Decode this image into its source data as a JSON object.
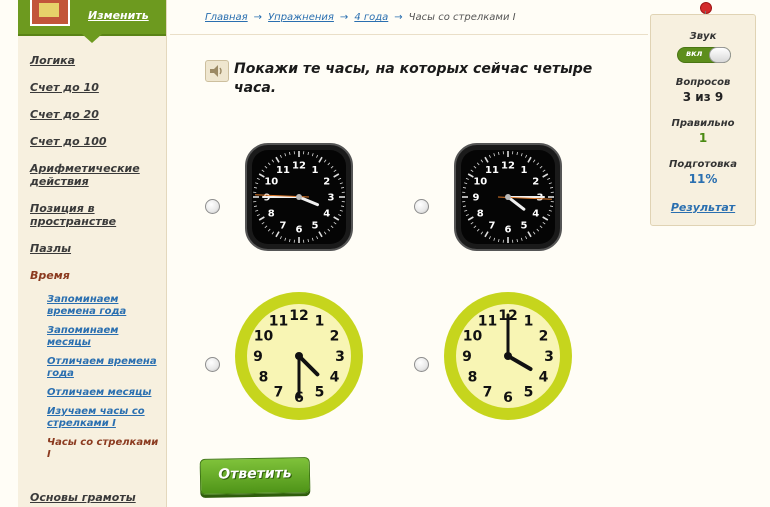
{
  "profile": {
    "change_label": "Изменить"
  },
  "menu": {
    "items": [
      {
        "label": "Логика"
      },
      {
        "label": "Счет до 10"
      },
      {
        "label": "Счет до 20"
      },
      {
        "label": "Счет до 100"
      },
      {
        "label": "Арифметические действия"
      },
      {
        "label": "Позиция в пространстве"
      },
      {
        "label": "Пазлы"
      },
      {
        "label": "Время"
      }
    ],
    "subitems": [
      {
        "label": "Запоминаем времена года"
      },
      {
        "label": "Запоминаем месяцы"
      },
      {
        "label": "Отличаем времена года"
      },
      {
        "label": "Отличаем месяцы"
      },
      {
        "label": "Изучаем часы со стрелками I"
      },
      {
        "label": "Часы со стрелками I"
      }
    ],
    "last_item": "Основы грамоты"
  },
  "breadcrumb": {
    "home": "Главная",
    "exercises": "Упражнения",
    "grade": "4 года",
    "current": "Часы со стрелками I",
    "separator": "→"
  },
  "question": {
    "text": "Покажи те часы, на которых сейчас четыре часа."
  },
  "options": [
    {
      "style": "square-black",
      "hour": 3,
      "minute": 45
    },
    {
      "style": "square-black",
      "hour": 4,
      "minute": 15
    },
    {
      "style": "round-yellow",
      "hour": 4,
      "minute": 30
    },
    {
      "style": "round-yellow",
      "hour": 4,
      "minute": 0
    }
  ],
  "clock_numbers": [
    "12",
    "1",
    "2",
    "3",
    "4",
    "5",
    "6",
    "7",
    "8",
    "9",
    "10",
    "11"
  ],
  "panel": {
    "sound_label": "Звук",
    "sound_toggle": "вкл",
    "questions_label": "Вопросов",
    "questions_value": "3 из 9",
    "correct_label": "Правильно",
    "correct_value": "1",
    "prep_label": "Подготовка",
    "prep_value": "11%",
    "result_link": "Результат"
  },
  "answer_button": {
    "label": "Ответить"
  },
  "colors": {
    "accent_green": "#6d9a1f",
    "link_blue": "#2a6fb0",
    "active_brown": "#8b3a1f",
    "value_green": "#4a8a12"
  }
}
